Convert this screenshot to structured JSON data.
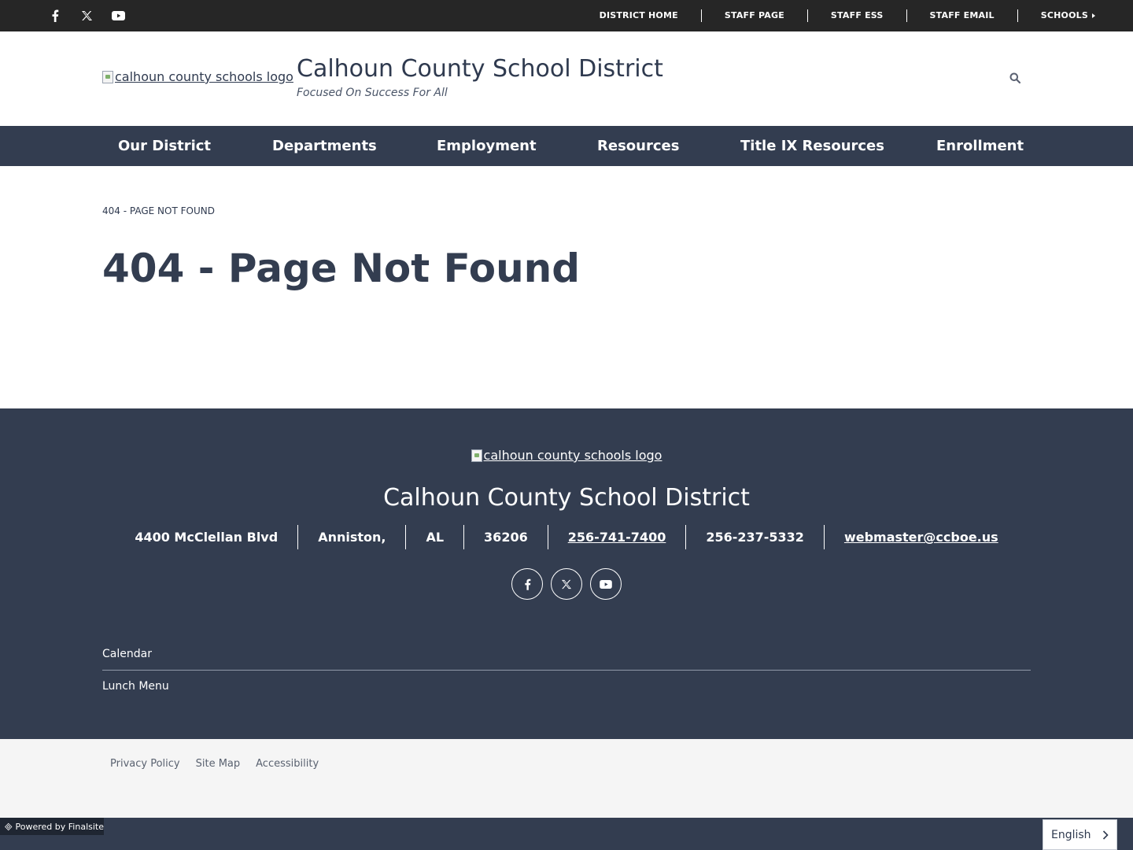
{
  "topbar": {
    "social": [
      {
        "icon": "facebook-icon"
      },
      {
        "icon": "x-twitter-icon"
      },
      {
        "icon": "youtube-icon"
      }
    ],
    "links": [
      "DISTRICT HOME",
      "STAFF PAGE",
      "STAFF ESS",
      "STAFF EMAIL",
      "SCHOOLS"
    ]
  },
  "header": {
    "logo_alt": "calhoun county schools logo",
    "title": "Calhoun County School District",
    "tagline": "Focused On Success For All",
    "search_icon": "search-icon"
  },
  "nav": {
    "items": [
      "Our District",
      "Departments",
      "Employment",
      "Resources",
      "Title IX Resources",
      "Enrollment"
    ]
  },
  "content": {
    "breadcrumb": "404 - PAGE NOT FOUND",
    "title": "404 - Page Not Found"
  },
  "footer": {
    "logo_alt": "calhoun county schools logo",
    "title": "Calhoun County School District",
    "address": "4400 McClellan Blvd",
    "city": "Anniston,",
    "state": "AL",
    "zip": "36206",
    "phone": "256-741-7400",
    "fax": "256-237-5332",
    "email": "webmaster@ccboe.us",
    "quick_links": [
      "Calendar",
      "Lunch Menu"
    ]
  },
  "legal": {
    "links": [
      "Privacy Policy",
      "Site Map",
      "Accessibility"
    ]
  },
  "powered": "Powered by Finalsite",
  "language": {
    "selected": "English"
  },
  "colors": {
    "navy": "#333d50",
    "topbar": "#262626",
    "legal_bg": "#f5f5f5"
  }
}
